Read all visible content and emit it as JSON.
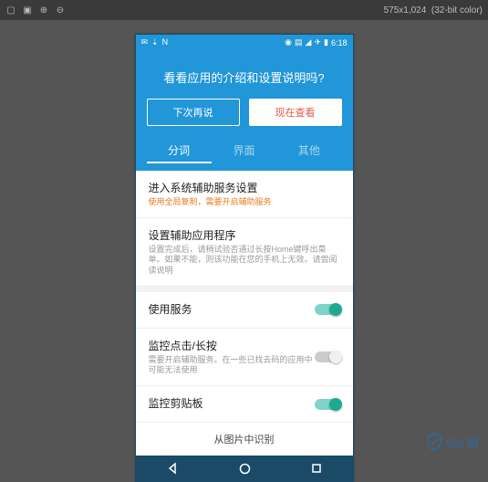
{
  "window": {
    "dimensions": "575x1,024",
    "color_depth": "(32-bit color)"
  },
  "statusbar": {
    "time": "6:18"
  },
  "header": {
    "title": "看看应用的介绍和设置说明吗?",
    "btn_later": "下次再说",
    "btn_now": "现在查看"
  },
  "tabs": {
    "t1": "分词",
    "t2": "界面",
    "t3": "其他"
  },
  "items": {
    "accessibility_title": "进入系统辅助服务设置",
    "accessibility_desc": "使用全局复制，需要开启辅助服务",
    "assist_title": "设置辅助应用程序",
    "assist_desc": "设置完成后，请稍试验否通过长按Home键呼出菜单。如果不能，则该功能在您的手机上无效。请尝阅读说明",
    "use_service": "使用服务",
    "monitor_click_title": "监控点击/长按",
    "monitor_click_desc": "需要开启辅助服务。在一些已找去码的应用中可能无法使用",
    "monitor_clipboard": "监控剪贴板",
    "from_image": "从图片中识别"
  },
  "watermark": {
    "text": "Gxl 网"
  }
}
